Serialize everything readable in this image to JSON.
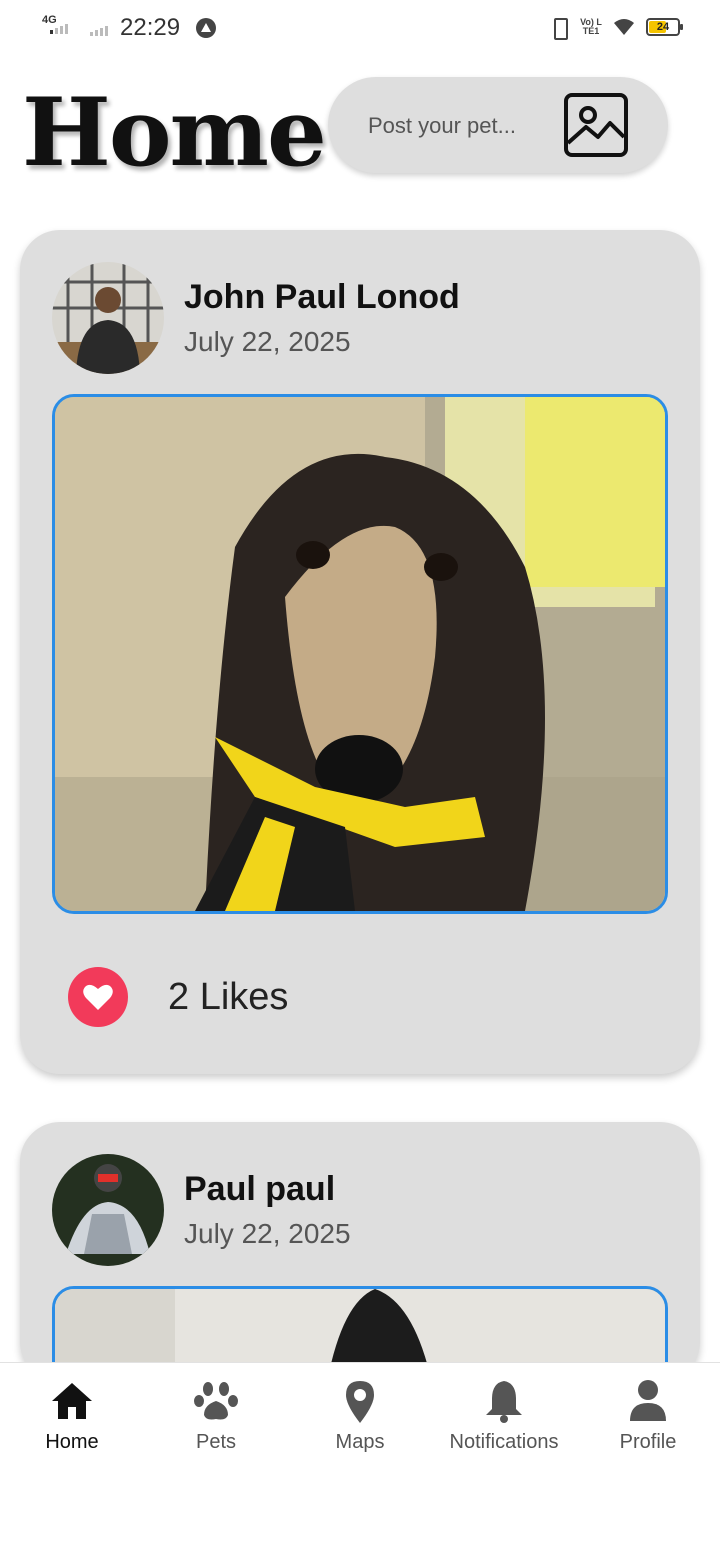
{
  "status_bar": {
    "network": "4G",
    "time": "22:29",
    "volte": "Vo) LTE1",
    "battery": "24"
  },
  "header": {
    "title": "Home",
    "post_placeholder": "Post your pet..."
  },
  "posts": [
    {
      "author": "John Paul Lonod",
      "date": "July 22, 2025",
      "likes_text": "2 Likes"
    },
    {
      "author": "Paul paul",
      "date": "July 22, 2025"
    }
  ],
  "nav": {
    "items": [
      {
        "label": "Home",
        "icon": "home-icon"
      },
      {
        "label": "Pets",
        "icon": "paw-icon"
      },
      {
        "label": "Maps",
        "icon": "map-pin-icon"
      },
      {
        "label": "Notifications",
        "icon": "bell-icon"
      },
      {
        "label": "Profile",
        "icon": "person-icon"
      }
    ],
    "active": "Home"
  },
  "colors": {
    "accent_border": "#2b8de6",
    "like": "#f23a5a",
    "card_bg": "#dedede"
  }
}
